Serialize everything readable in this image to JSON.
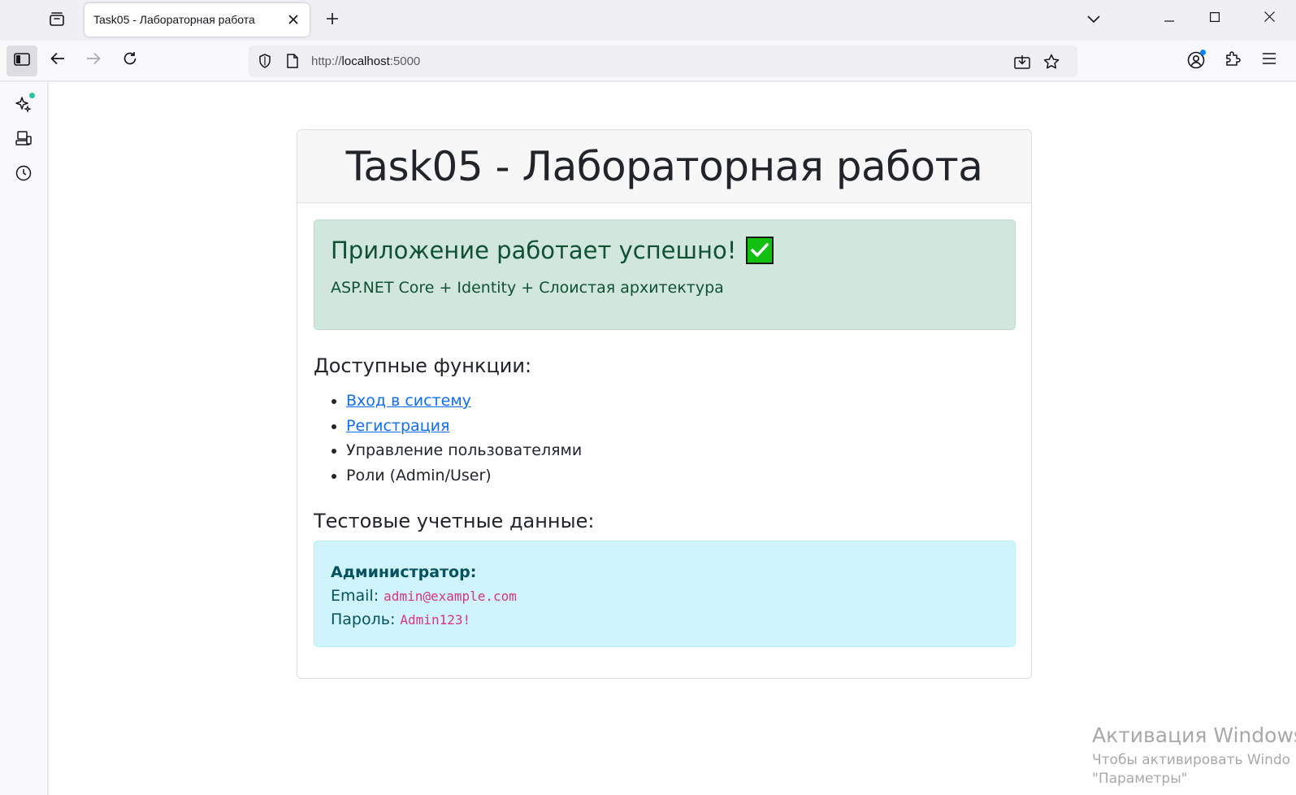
{
  "browser": {
    "tab_title": "Task05 - Лабораторная работа",
    "url_prefix": "http://",
    "url_host": "localhost",
    "url_suffix": ":5000"
  },
  "page": {
    "header": "Task05 - Лабораторная работа",
    "success_title": "Приложение работает успешно!",
    "success_icon": "check-mark-button-emoji",
    "success_text": "ASP.NET Core + Identity + Слоистая архитектура",
    "features_title": "Доступные функции:",
    "features": [
      {
        "label": "Вход в систему",
        "link": true
      },
      {
        "label": "Регистрация",
        "link": true
      },
      {
        "label": "Управление пользователями",
        "link": false
      },
      {
        "label": "Роли (Admin/User)",
        "link": false
      }
    ],
    "credentials_title": "Тестовые учетные данные:",
    "credentials": {
      "role_label": "Администратор:",
      "email_label": "Email:",
      "email_value": "admin@example.com",
      "password_label": "Пароль:",
      "password_value": "Admin123!"
    }
  },
  "watermark": {
    "line1": "Активация Windows",
    "line2": "Чтобы активировать Windo",
    "line3": "\"Параметры\""
  },
  "colors": {
    "success_bg": "#d1e7dd",
    "success_text": "#0f5132",
    "info_bg": "#cff4fc",
    "info_text": "#055160",
    "link": "#0d6efd",
    "code": "#d63384"
  }
}
